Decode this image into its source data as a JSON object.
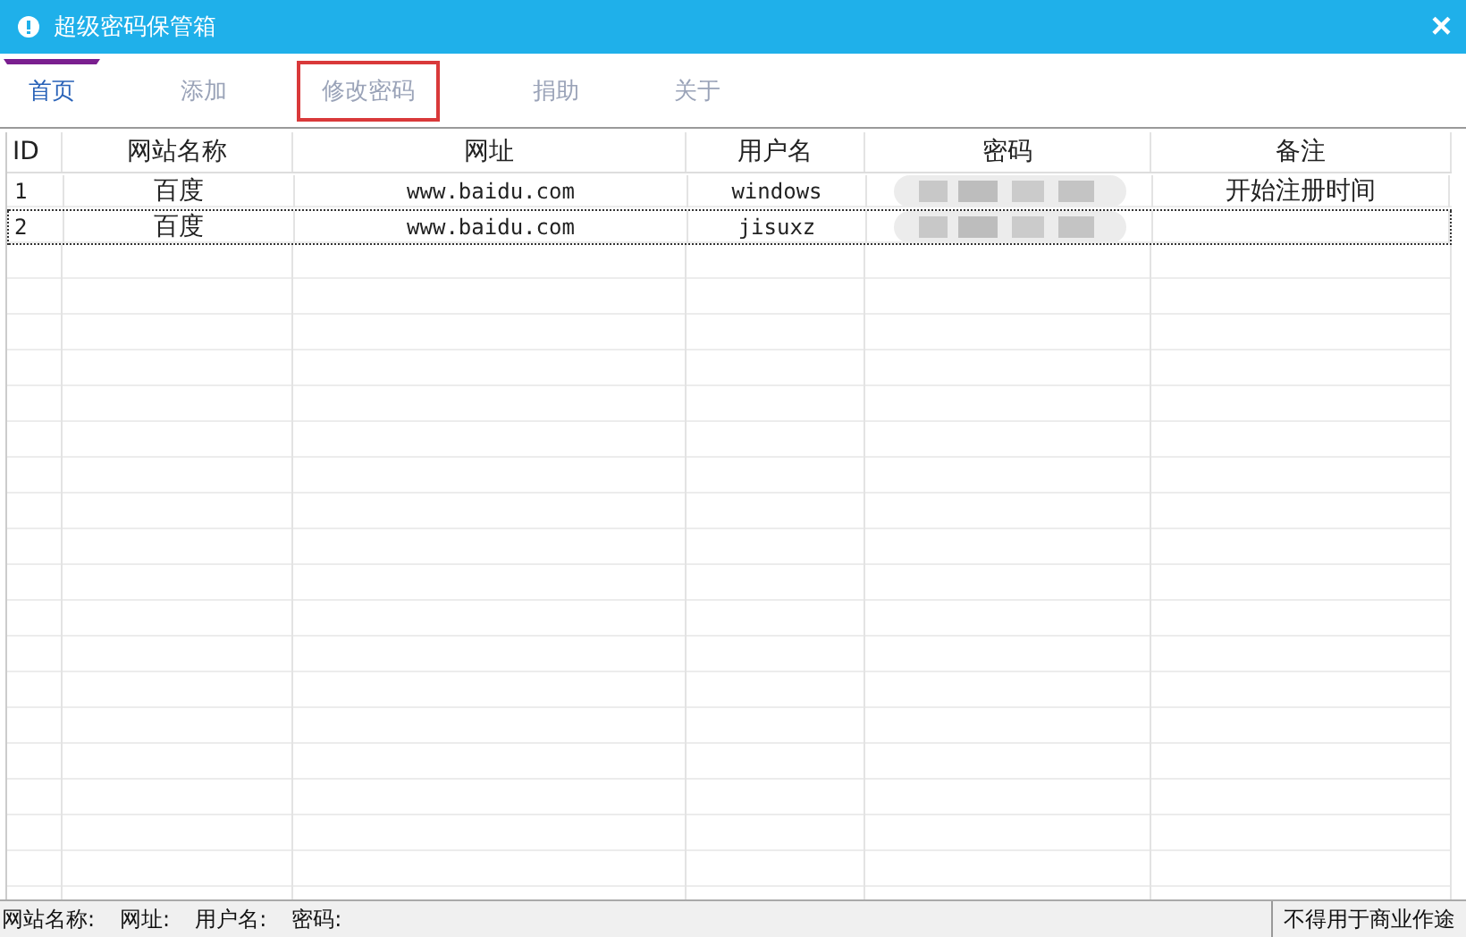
{
  "window": {
    "title": "超级密码保管箱",
    "close": "×"
  },
  "tabs": [
    {
      "label": "首页",
      "selected": true,
      "highlighted": false
    },
    {
      "label": "添加",
      "selected": false,
      "highlighted": false
    },
    {
      "label": "修改密码",
      "selected": false,
      "highlighted": true
    },
    {
      "label": "捐助",
      "selected": false,
      "highlighted": false
    },
    {
      "label": "关于",
      "selected": false,
      "highlighted": false
    }
  ],
  "table": {
    "columns": [
      "ID",
      "网站名称",
      "网址",
      "用户名",
      "密码",
      "备注"
    ],
    "rows": [
      {
        "id": "1",
        "name": "百度",
        "url": "www.baidu.com",
        "user": "windows",
        "password_redacted": true,
        "note": "开始注册时间",
        "selected": false
      },
      {
        "id": "2",
        "name": "百度",
        "url": "www.baidu.com",
        "user": "jisuxz",
        "password_redacted": true,
        "note": "",
        "selected": true
      }
    ]
  },
  "status_bar": {
    "fields": [
      "网站名称:",
      "网址:",
      "用户名:",
      "密码:"
    ],
    "notice": "不得用于商业作途"
  }
}
